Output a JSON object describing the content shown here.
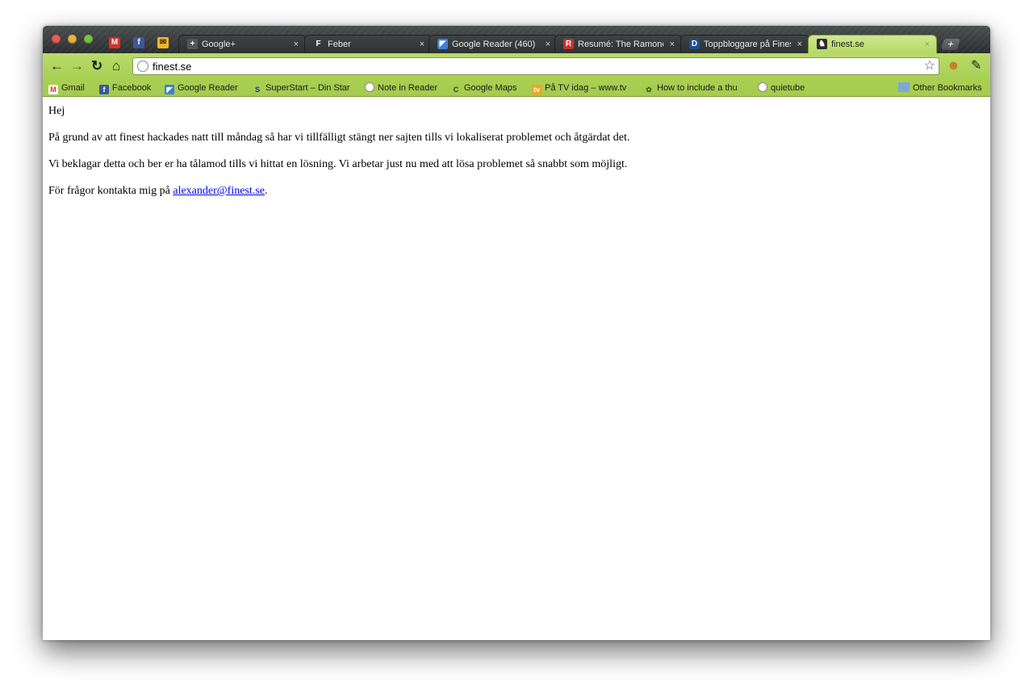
{
  "browser": {
    "tabs": [
      {
        "title": "Google+",
        "favicon": "google-plus-icon",
        "active": false
      },
      {
        "title": "Feber",
        "favicon": "feber-icon",
        "active": false
      },
      {
        "title": "Google Reader (460)",
        "favicon": "google-reader-icon",
        "active": false
      },
      {
        "title": "Resumé: The Ramones",
        "favicon": "resume-icon",
        "active": false
      },
      {
        "title": "Toppbloggare på Fines",
        "favicon": "dm-icon",
        "active": false
      },
      {
        "title": "finest.se",
        "favicon": "finest-icon",
        "active": true
      }
    ],
    "tab_close_glyph": "×",
    "new_tab_glyph": "+",
    "address": "finest.se",
    "bookmarks": [
      {
        "label": "Gmail",
        "icon": "gmail-icon"
      },
      {
        "label": "Facebook",
        "icon": "facebook-icon"
      },
      {
        "label": "Google Reader",
        "icon": "google-reader-icon"
      },
      {
        "label": "SuperStart – Din Star",
        "icon": "superstart-icon"
      },
      {
        "label": "Note in Reader",
        "icon": "globe-icon"
      },
      {
        "label": "Google Maps",
        "icon": "google-maps-icon"
      },
      {
        "label": "På TV idag – www.tv",
        "icon": "tv-icon"
      },
      {
        "label": "How to include a thu",
        "icon": "cactus-icon"
      },
      {
        "label": "quietube",
        "icon": "globe-icon"
      }
    ],
    "other_bookmarks": "Other Bookmarks"
  },
  "page": {
    "greeting": "Hej",
    "paragraph1": "På grund av att finest hackades natt till måndag så har vi tillfälligt stängt ner sajten tills vi lokaliserat problemet och åtgärdat det.",
    "paragraph2": "Vi beklagar detta och ber er ha tålamod tills vi hittat en lösning. Vi arbetar just nu med att lösa problemet så snabbt som möjligt.",
    "contact_prefix": "För frågor kontakta mig på ",
    "contact_email": "alexander@finest.se",
    "contact_suffix": "."
  },
  "colors": {
    "chrome_theme_green": "#b2d65e",
    "tabstrip_dark": "#2e3132",
    "link": "#0000ee"
  }
}
